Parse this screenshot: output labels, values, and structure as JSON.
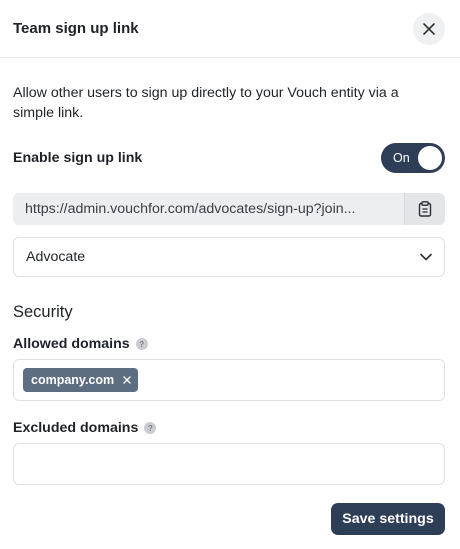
{
  "header": {
    "title": "Team sign up link"
  },
  "description": "Allow other users to sign up directly to your Vouch entity via a simple link.",
  "enable": {
    "label": "Enable sign up link",
    "toggle_label": "On",
    "enabled": true
  },
  "link": {
    "url": "https://admin.vouchfor.com/advocates/sign-up?join..."
  },
  "role_select": {
    "selected": "Advocate"
  },
  "security": {
    "title": "Security",
    "allowed": {
      "label": "Allowed domains",
      "chips": [
        "company.com"
      ]
    },
    "excluded": {
      "label": "Excluded domains",
      "value": ""
    }
  },
  "actions": {
    "save_label": "Save settings"
  },
  "colors": {
    "primary": "#2f3e57",
    "chip": "#5d6e83",
    "link_bg": "#eceef1"
  },
  "icons": {
    "close": "close-icon",
    "copy": "clipboard-icon",
    "dropdown": "chevron-down-icon",
    "help": "help-icon",
    "remove": "remove-chip-icon"
  }
}
